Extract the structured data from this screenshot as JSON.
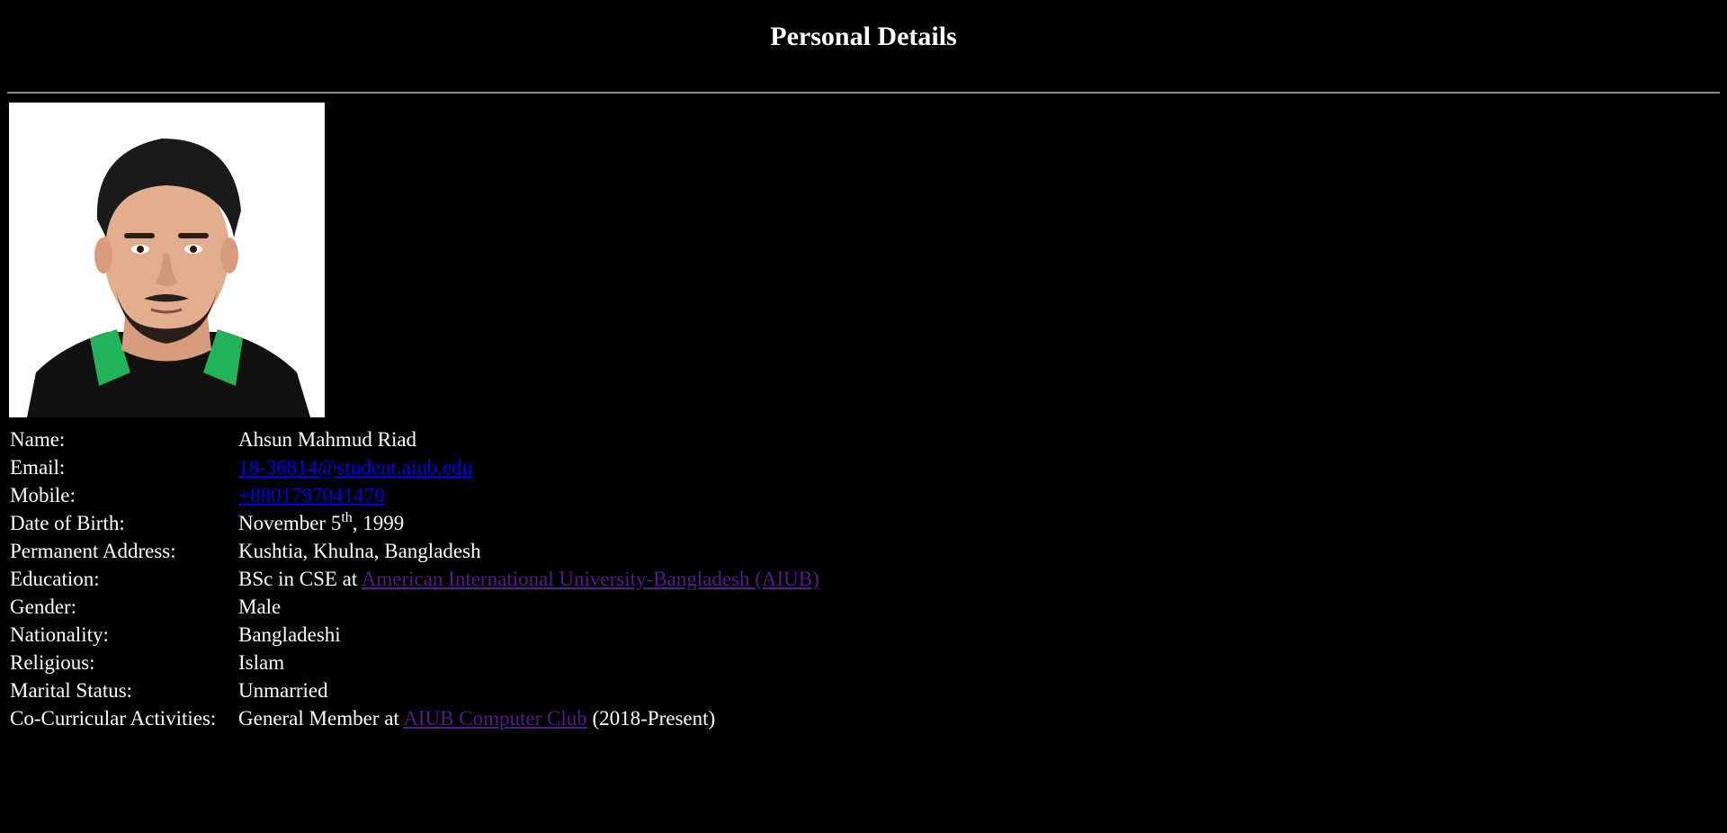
{
  "page": {
    "title": "Personal Details"
  },
  "photo": {
    "alt": "Profile photo"
  },
  "details": {
    "name": {
      "label": "Name:",
      "value": "Ahsun Mahmud Riad"
    },
    "email": {
      "label": "Email:",
      "link": "18-36814@student.aiub.edu"
    },
    "mobile": {
      "label": "Mobile:",
      "link": "+8801797041470"
    },
    "dob": {
      "label": "Date of Birth:",
      "prefix": "November 5",
      "sup": "th",
      "suffix": ", 1999"
    },
    "address": {
      "label": "Permanent Address:",
      "value": "Kushtia, Khulna, Bangladesh"
    },
    "education": {
      "label": "Education:",
      "prefix": "BSc in CSE at ",
      "link": "American International University-Bangladesh (AIUB)"
    },
    "gender": {
      "label": "Gender:",
      "value": "Male"
    },
    "nationality": {
      "label": "Nationality:",
      "value": "Bangladeshi"
    },
    "religious": {
      "label": "Religious:",
      "value": "Islam"
    },
    "marital": {
      "label": "Marital Status:",
      "value": "Unmarried"
    },
    "activities": {
      "label": "Co-Curricular Activities:",
      "prefix": "General Member at ",
      "link": "AIUB Computer Club",
      "suffix": " (2018-Present)"
    }
  },
  "colors": {
    "background": "#000000",
    "text": "#ffffff",
    "link_unvisited": "#0000ee",
    "link_visited": "#551a8b",
    "divider": "#8a8a8a",
    "shirt_collar": "#22b35a"
  }
}
